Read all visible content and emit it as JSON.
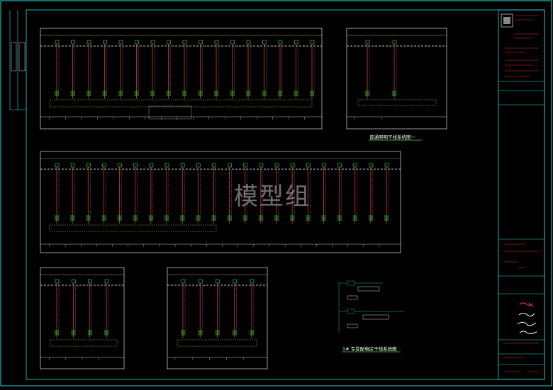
{
  "watermark": "模型组",
  "captions": {
    "lighting": "普通照明干线系统图一",
    "special": "1# 专变配电房干线系统图"
  },
  "colors": {
    "frame": "#2fd8d8",
    "feeder": "#d23b3b",
    "cable": "#c050d8",
    "breaker": "#39e039",
    "bus": "#ffffff",
    "label_band": "#cccc40"
  }
}
